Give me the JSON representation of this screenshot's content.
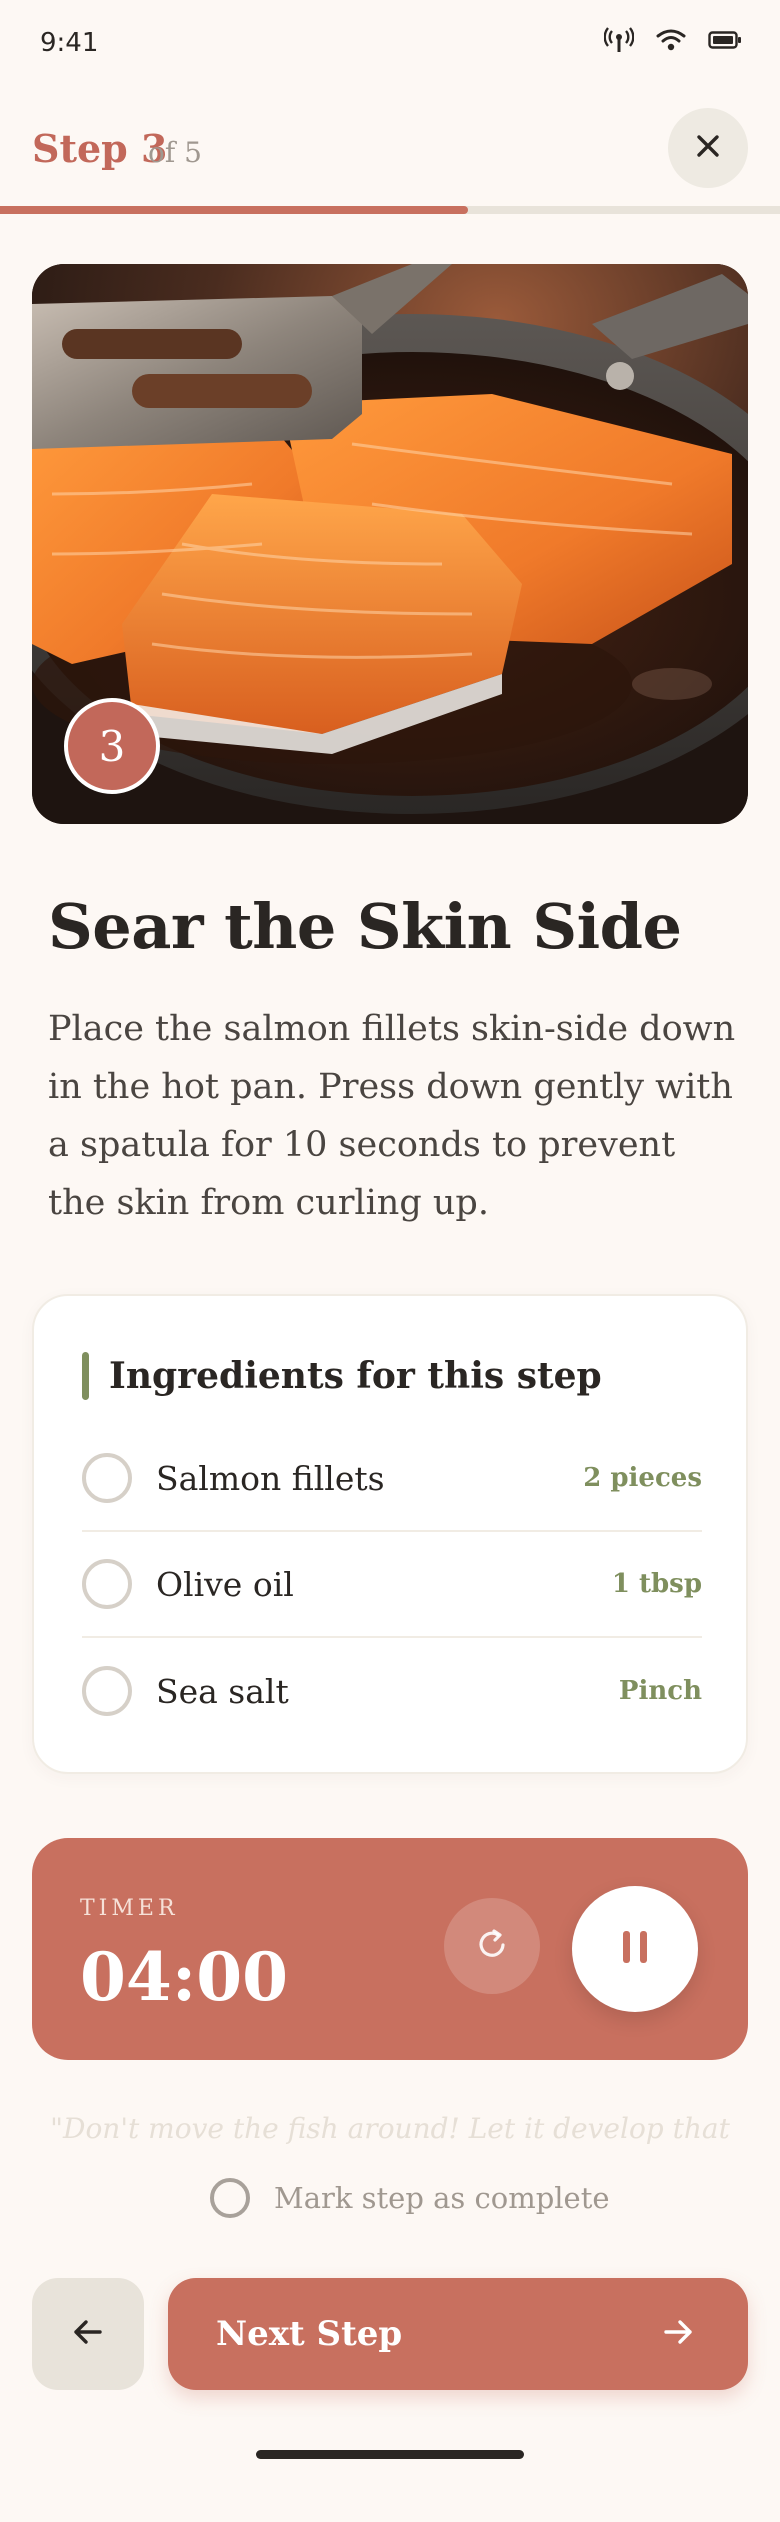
{
  "status_bar": {
    "time": "9:41",
    "icons": [
      "signal-icon",
      "wifi-icon",
      "battery-icon"
    ]
  },
  "header": {
    "step_label": "Step 3",
    "step_of": "of 5",
    "progress": 0.6,
    "close_icon": "close-icon"
  },
  "hero": {
    "badge_number": "3",
    "image_subject": "salmon fillets searing in a pan with a spatula"
  },
  "step": {
    "title": "Sear the Skin Side",
    "description": "Place the salmon fillets skin-side down in the hot pan. Press down gently with a spatula for 10 seconds to prevent the skin from curling up."
  },
  "ingredients": {
    "title": "Ingredients for this step",
    "items": [
      {
        "name": "Salmon fillets",
        "quantity": "2 pieces",
        "checked": false
      },
      {
        "name": "Olive oil",
        "quantity": "1 tbsp",
        "checked": false
      },
      {
        "name": "Sea salt",
        "quantity": "Pinch",
        "checked": false
      }
    ]
  },
  "timer": {
    "label": "TIMER",
    "value": "04:00",
    "reset_icon": "reset-icon",
    "pause_icon": "pause-icon"
  },
  "tip": {
    "text": "\"Don't move the fish around! Let it develop that"
  },
  "mark_complete": {
    "label": "Mark step as complete",
    "checked": false
  },
  "nav": {
    "back_icon": "arrow-left-icon",
    "next_label": "Next Step",
    "next_icon": "arrow-right-icon"
  },
  "colors": {
    "accent": "#C8705F",
    "accent_text": "#C2685A",
    "background": "#FDF8F4",
    "herb": "#7F8F5E",
    "neutral_button": "#E8E3DA"
  }
}
